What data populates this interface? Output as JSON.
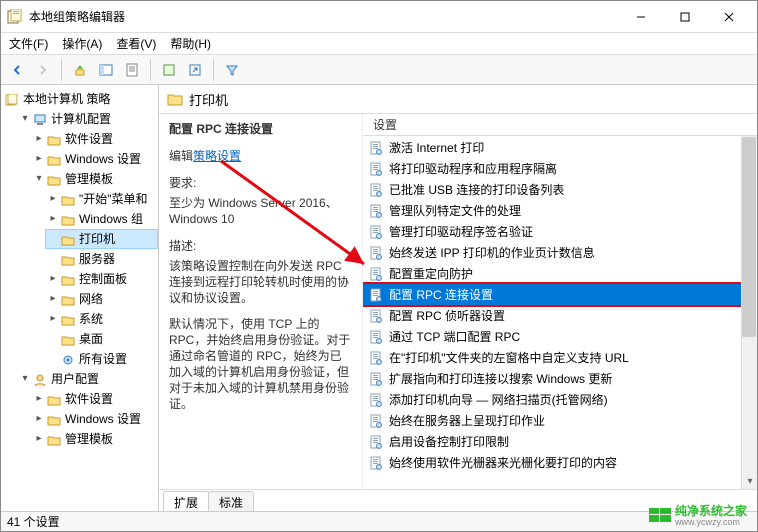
{
  "window": {
    "title": "本地组策略编辑器"
  },
  "menu": {
    "file": "文件(F)",
    "action": "操作(A)",
    "view": "查看(V)",
    "help": "帮助(H)"
  },
  "tree": {
    "root": "本地计算机 策略",
    "computer_config": "计算机配置",
    "software_settings": "软件设置",
    "windows_settings": "Windows 设置",
    "admin_templates": "管理模板",
    "start_menu": "\"开始\"菜单和",
    "windows_group": "Windows 组",
    "printers": "打印机",
    "server": "服务器",
    "control_panel": "控制面板",
    "network": "网络",
    "system": "系统",
    "desktop": "桌面",
    "all_settings": "所有设置",
    "user_config": "用户配置",
    "u_software_settings": "软件设置",
    "u_windows_settings": "Windows 设置",
    "u_admin_templates": "管理模板"
  },
  "current_folder": "打印机",
  "detail": {
    "title": "配置 RPC 连接设置",
    "edit_prefix": "编辑",
    "edit_link": "策略设置",
    "req_label": "要求:",
    "req_text": "至少为 Windows Server 2016、Windows 10",
    "desc_label": "描述:",
    "desc_p1": "该策略设置控制在向外发送 RPC 连接到远程打印轮转机时使用的协议和协议设置。",
    "desc_p2": "默认情况下，使用 TCP 上的 RPC，并始终启用身份验证。对于通过命名管道的 RPC，始终为已加入域的计算机启用身份验证，但对于未加入域的计算机禁用身份验证。"
  },
  "list": {
    "header": "设置",
    "items": [
      "激活 Internet 打印",
      "将打印驱动程序和应用程序隔离",
      "已批准 USB 连接的打印设备列表",
      "管理队列特定文件的处理",
      "管理打印驱动程序签名验证",
      "始终发送 IPP 打印机的作业页计数信息",
      "配置重定向防护",
      "配置 RPC 连接设置",
      "配置 RPC 侦听器设置",
      "通过 TCP 端口配置 RPC",
      "在\"打印机\"文件夹的左窗格中自定义支持 URL",
      "扩展指向和打印连接以搜索 Windows 更新",
      "添加打印机向导 — 网络扫描页(托管网络)",
      "始终在服务器上呈现打印作业",
      "启用设备控制打印限制",
      "始终使用软件光栅器来光栅化要打印的内容"
    ],
    "selected_index": 7
  },
  "tabs": {
    "extended": "扩展",
    "standard": "标准"
  },
  "status": "41 个设置",
  "watermark": {
    "brand": "纯净系统之家",
    "url": "www.ycwzy.com"
  }
}
